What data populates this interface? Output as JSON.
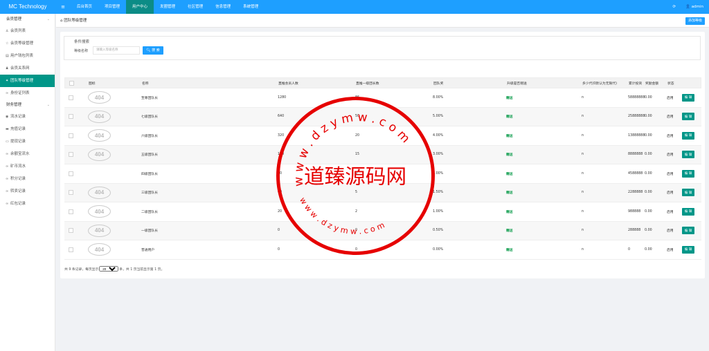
{
  "header": {
    "logo": "MC Technology",
    "menu_icon": "≡",
    "nav": [
      "后台首页",
      "项目管理",
      "用户中心",
      "发圈管理",
      "社区管理",
      "信息管理",
      "系统管理"
    ],
    "active_nav": 2,
    "refresh_icon": "⟳",
    "user": "admin"
  },
  "sidebar": {
    "groups": [
      {
        "label": "会员管理",
        "items": [
          {
            "icon": "user-icon",
            "label": "会员列表"
          },
          {
            "icon": "star-icon",
            "label": "会员等级管理"
          },
          {
            "icon": "wallet-icon",
            "label": "用户钱包列表"
          },
          {
            "icon": "users-icon",
            "label": "会员关系网"
          },
          {
            "icon": "team-icon",
            "label": "团队等级管理",
            "active": true
          },
          {
            "icon": "link-icon",
            "label": "身份证列表"
          }
        ]
      },
      {
        "label": "财务管理",
        "items": [
          {
            "icon": "flow-icon",
            "label": "流水记录"
          },
          {
            "icon": "card-icon",
            "label": "充值记录"
          },
          {
            "icon": "withdraw-icon",
            "label": "提现记录"
          },
          {
            "icon": "link-icon",
            "label": "余额宝流水"
          },
          {
            "icon": "link-icon",
            "label": "矿币流水"
          },
          {
            "icon": "link-icon",
            "label": "积分记录"
          },
          {
            "icon": "link-icon",
            "label": "转卖记录"
          },
          {
            "icon": "link-icon",
            "label": "红包记录"
          }
        ]
      }
    ]
  },
  "breadcrumb": "团队等级管理",
  "add_button": "添加等级",
  "search": {
    "title": "条件搜索",
    "label": "等级名称",
    "placeholder": "请输入等级名称",
    "button": "搜 索"
  },
  "table": {
    "headers": [
      "图标",
      "名称",
      "直推会员人数",
      "直推一级团长数",
      "团队奖",
      "升级是否赠送",
      "多少代(0默认为无限代)",
      "累计投资",
      "奖励金额",
      "状态",
      ""
    ],
    "rows": [
      {
        "icon": "404",
        "name": "至尊团队长",
        "direct": "1280",
        "leaders": "86",
        "bonus": "8.00%",
        "gift": "赠送",
        "gen": "n",
        "invest": "58888888",
        "reward": "0.00",
        "status": "启用",
        "action": "编 辑"
      },
      {
        "icon": "404",
        "name": "七级团队长",
        "direct": "640",
        "leaders": "50",
        "bonus": "5.00%",
        "gift": "赠送",
        "gen": "n",
        "invest": "25888888",
        "reward": "0.00",
        "status": "启用",
        "action": "编 辑"
      },
      {
        "icon": "404",
        "name": "六级团队长",
        "direct": "320",
        "leaders": "20",
        "bonus": "4.00%",
        "gift": "赠送",
        "gen": "n",
        "invest": "13888888",
        "reward": "0.00",
        "status": "启用",
        "action": "编 辑"
      },
      {
        "icon": "404",
        "name": "五级团队长",
        "direct": "160",
        "leaders": "15",
        "bonus": "3.00%",
        "gift": "赠送",
        "gen": "n",
        "invest": "8888888",
        "reward": "0.00",
        "status": "启用",
        "action": "编 辑"
      },
      {
        "icon": "",
        "name": "四级团队长",
        "direct": "80",
        "leaders": "9",
        "bonus": "2.00%",
        "gift": "赠送",
        "gen": "n",
        "invest": "4588888",
        "reward": "0.00",
        "status": "启用",
        "action": "编 辑"
      },
      {
        "icon": "404",
        "name": "三级团队长",
        "direct": "40",
        "leaders": "5",
        "bonus": "1.50%",
        "gift": "赠送",
        "gen": "n",
        "invest": "2288888",
        "reward": "0.00",
        "status": "启用",
        "action": "编 辑"
      },
      {
        "icon": "404",
        "name": "二级团队长",
        "direct": "20",
        "leaders": "2",
        "bonus": "1.00%",
        "gift": "赠送",
        "gen": "n",
        "invest": "988888",
        "reward": "0.00",
        "status": "启用",
        "action": "编 辑"
      },
      {
        "icon": "404",
        "name": "一级团队长",
        "direct": "0",
        "leaders": "0",
        "bonus": "0.50%",
        "gift": "赠送",
        "gen": "n",
        "invest": "288888",
        "reward": "0.00",
        "status": "启用",
        "action": "编 辑"
      },
      {
        "icon": "404",
        "name": "普通用户",
        "direct": "0",
        "leaders": "0",
        "bonus": "0.00%",
        "gift": "赠送",
        "gen": "n",
        "invest": "0",
        "reward": "0.00",
        "status": "启用",
        "action": "编 辑"
      }
    ]
  },
  "pager": {
    "prefix": "共 9 条记录，每页显示",
    "per_page": "20",
    "suffix": "条，共 1 页当前显示第 1 页。"
  },
  "watermark": {
    "top": "w w w . d z y m w . c o m",
    "center": "道臻源码网",
    "bottom": "w w w . d z y m w . c o m"
  },
  "colors": {
    "header": "#1e9fff",
    "active": "#009688",
    "stamp": "#e60000"
  }
}
